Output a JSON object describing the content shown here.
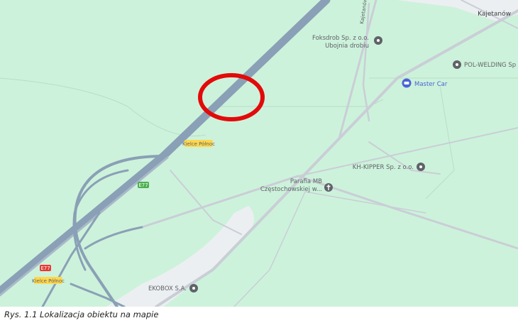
{
  "map": {
    "place_labels": {
      "kajetanow": "Kajetanów",
      "foksdrob_1": "Foksdrob Sp. z o.o.",
      "foksdrob_2": "Ubojnia drobiu",
      "pol_welding": "POL-WELDING Sp",
      "master_car": "Master Car",
      "kh_kipper": "KH-KIPPER Sp. z o.o.",
      "parafia_1": "Parafia MB",
      "parafia_2": "Częstochowskiej w...",
      "ekobox": "EKOBOX S.A.",
      "street_kajetanow": "Kajetanów"
    },
    "road_labels": {
      "kielce_polnoc_upper": "Kielce Północ",
      "kielce_polnoc_lower": "Kielce Północ",
      "e77_upper": "E77",
      "e77_lower": "E77"
    },
    "icons": {
      "foksdrob": "poi-pin-icon",
      "pol_welding": "poi-pin-icon",
      "master_car": "car-repair-icon",
      "kh_kipper": "poi-pin-icon",
      "parafia": "church-icon",
      "ekobox": "poi-pin-icon"
    },
    "colors": {
      "land": "#cdf2db",
      "highway": "#8aa0b6",
      "road": "#c9ced6",
      "urban": "#eceff1",
      "marker": "#e30a0a",
      "poi": "#5f6368",
      "shopping_poi": "#4a63d6",
      "road_shield": "#ffd84d",
      "e_route_shield": "#4caf50"
    },
    "marker": "location-circle"
  },
  "caption": "Rys. 1.1 Lokalizacja obiektu na mapie"
}
